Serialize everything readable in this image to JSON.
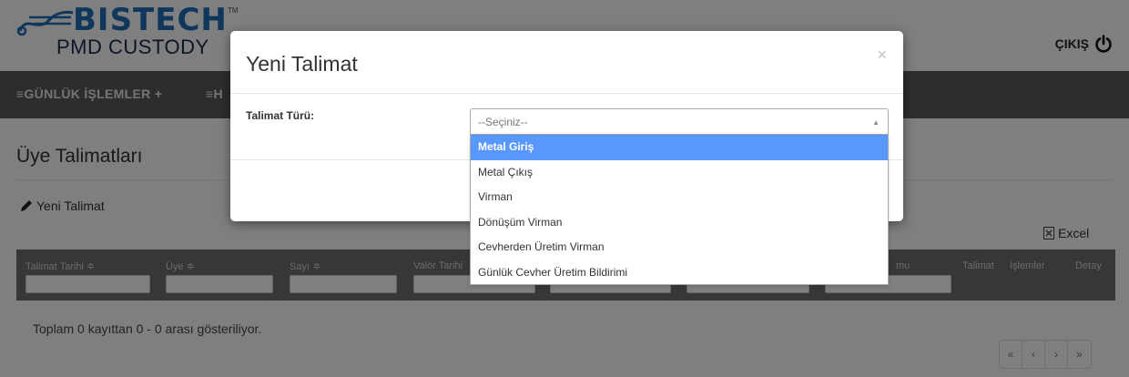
{
  "header": {
    "brand_name": "BISTECH",
    "brand_tm": "TM",
    "product_name": "PMD CUSTODY",
    "logout_label": "ÇIKIŞ"
  },
  "nav": {
    "items": [
      {
        "label": "≡GÜNLÜK İŞLEMLER  +"
      },
      {
        "label": "≡H"
      }
    ]
  },
  "page": {
    "title": "Üye Talimatları",
    "new_link": "Yeni Talimat",
    "excel_link": "Excel",
    "summary": "Toplam 0 kayıttan 0 - 0 arası gösteriliyor."
  },
  "grid": {
    "columns": [
      {
        "label": "Talimat Tarihi ≑"
      },
      {
        "label": "Üye ≑"
      },
      {
        "label": "Sayı ≑"
      },
      {
        "label": "Valör Tarihi"
      },
      {
        "label": "mu"
      },
      {
        "label": "Talimat"
      },
      {
        "label": "İşlemler"
      },
      {
        "label": "Detay"
      }
    ]
  },
  "pager": {
    "first": "«",
    "prev": "‹",
    "next": "›",
    "last": "»"
  },
  "modal": {
    "title": "Yeni Talimat",
    "close": "×",
    "field_label": "Talimat Türü:",
    "select_value": "--Seçiniz--",
    "options": [
      {
        "label": "Metal Giriş",
        "highlighted": true
      },
      {
        "label": "Metal Çıkış",
        "highlighted": false
      },
      {
        "label": "Virman",
        "highlighted": false
      },
      {
        "label": "Dönüşüm Virman",
        "highlighted": false
      },
      {
        "label": "Cevherden Üretim Virman",
        "highlighted": false
      },
      {
        "label": "Günlük Cevher Üretim Bildirimi",
        "highlighted": false
      }
    ]
  },
  "colors": {
    "navbar": "#5a5a5a",
    "grid_header": "#6e6e6e",
    "brand_blue": "#1e6fb8",
    "option_highlight": "#5897fb"
  },
  "icons": {
    "logo": "bistech-logo-icon",
    "logout": "power-icon",
    "new": "pencil-icon",
    "excel": "excel-file-icon",
    "select_arrow": "triangle-up-icon"
  }
}
